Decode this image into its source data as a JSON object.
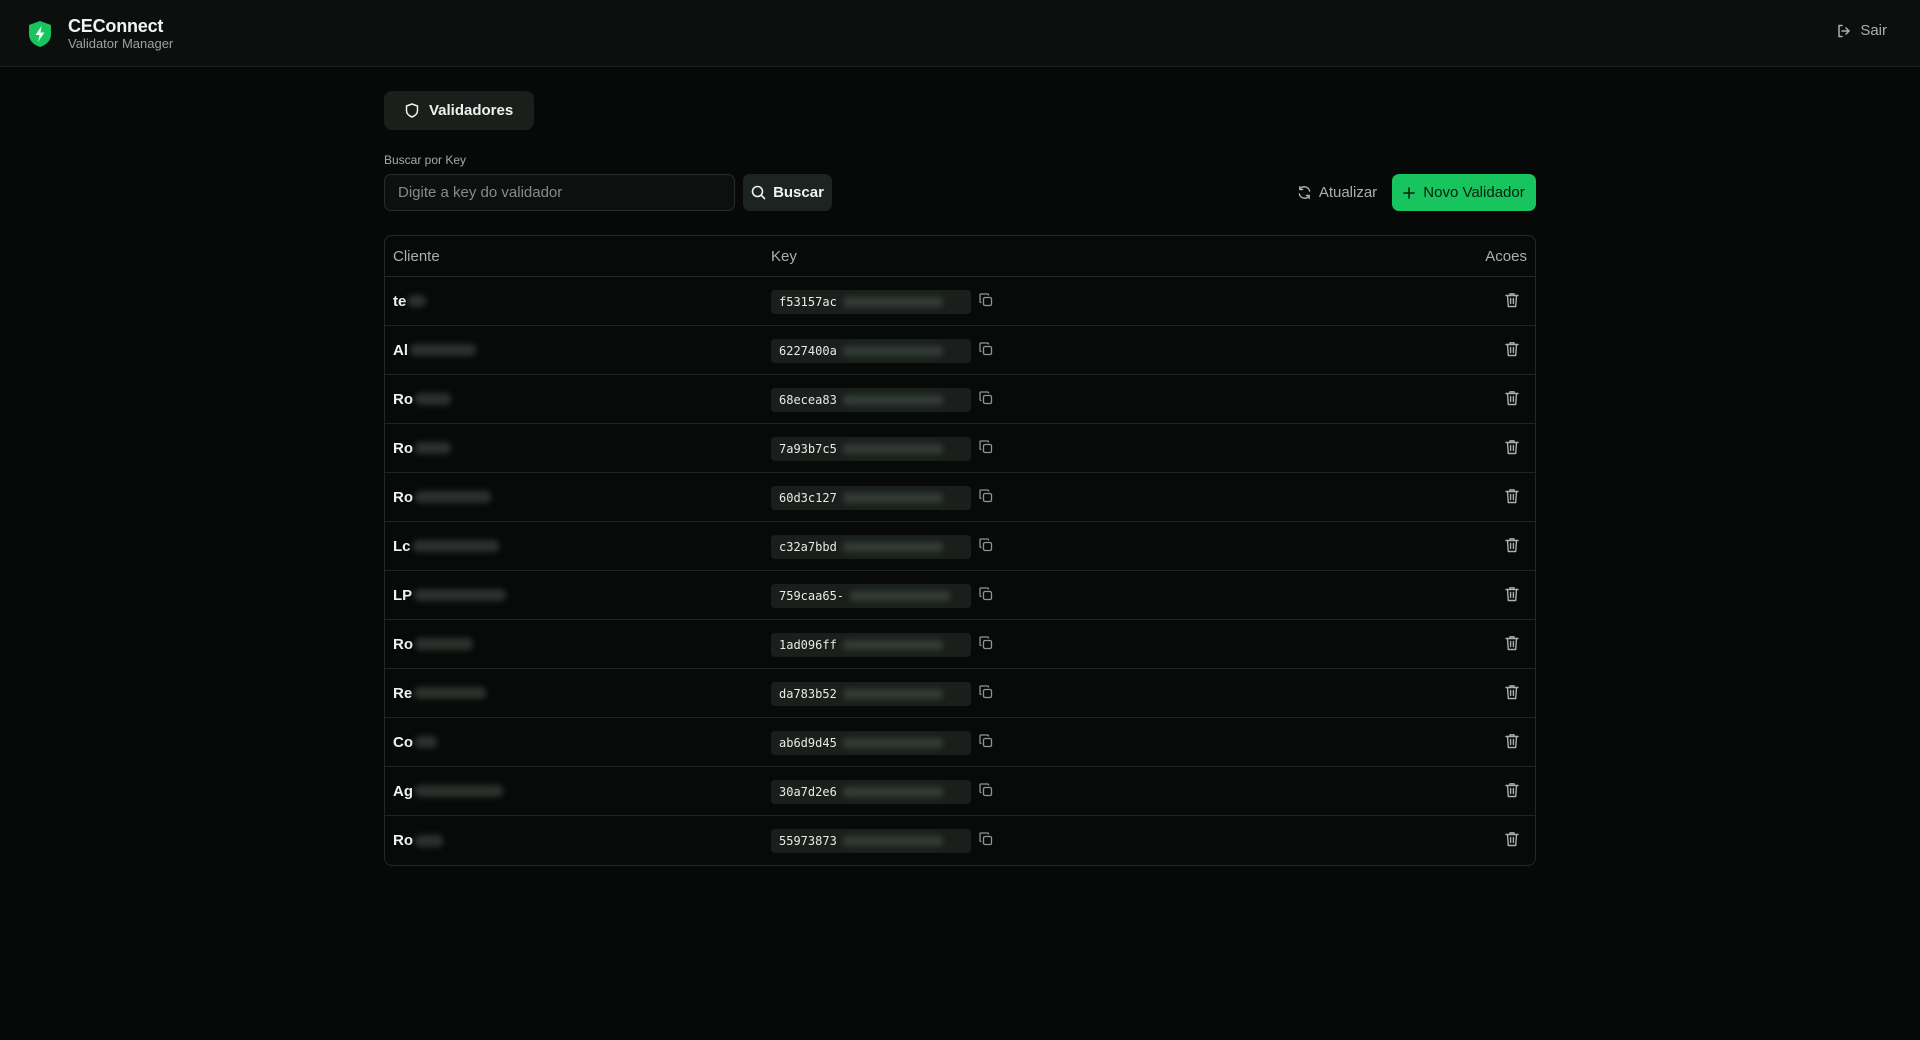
{
  "app": {
    "title": "CEConnect",
    "subtitle": "Validator Manager",
    "logout_label": "Sair"
  },
  "tabs": {
    "active_label": "Validadores"
  },
  "search": {
    "label": "Buscar por Key",
    "placeholder": "Digite a key do validador",
    "value": "",
    "button_label": "Buscar"
  },
  "actions": {
    "refresh_label": "Atualizar",
    "new_label": "Novo Validador"
  },
  "table": {
    "headers": {
      "client": "Cliente",
      "key": "Key",
      "actions": "Acoes"
    },
    "rows": [
      {
        "client": "te",
        "key": "f53157ac"
      },
      {
        "client": "Al",
        "key": "6227400a"
      },
      {
        "client": "Ro",
        "key": "68ecea83"
      },
      {
        "client": "Ro",
        "key": "7a93b7c5"
      },
      {
        "client": "Ro",
        "key": "60d3c127"
      },
      {
        "client": "Lc",
        "key": "c32a7bbd"
      },
      {
        "client": "LP",
        "key": "759caa65-"
      },
      {
        "client": "Ro",
        "key": "1ad096ff"
      },
      {
        "client": "Re",
        "key": "da783b52"
      },
      {
        "client": "Co",
        "key": "ab6d9d45"
      },
      {
        "client": "Ag",
        "key": "30a7d2e6"
      },
      {
        "client": "Ro",
        "key": "55973873"
      }
    ]
  },
  "colors": {
    "background": "#070908",
    "accent": "#17c45e",
    "surface": "#1a1f1c",
    "border": "#232925"
  }
}
